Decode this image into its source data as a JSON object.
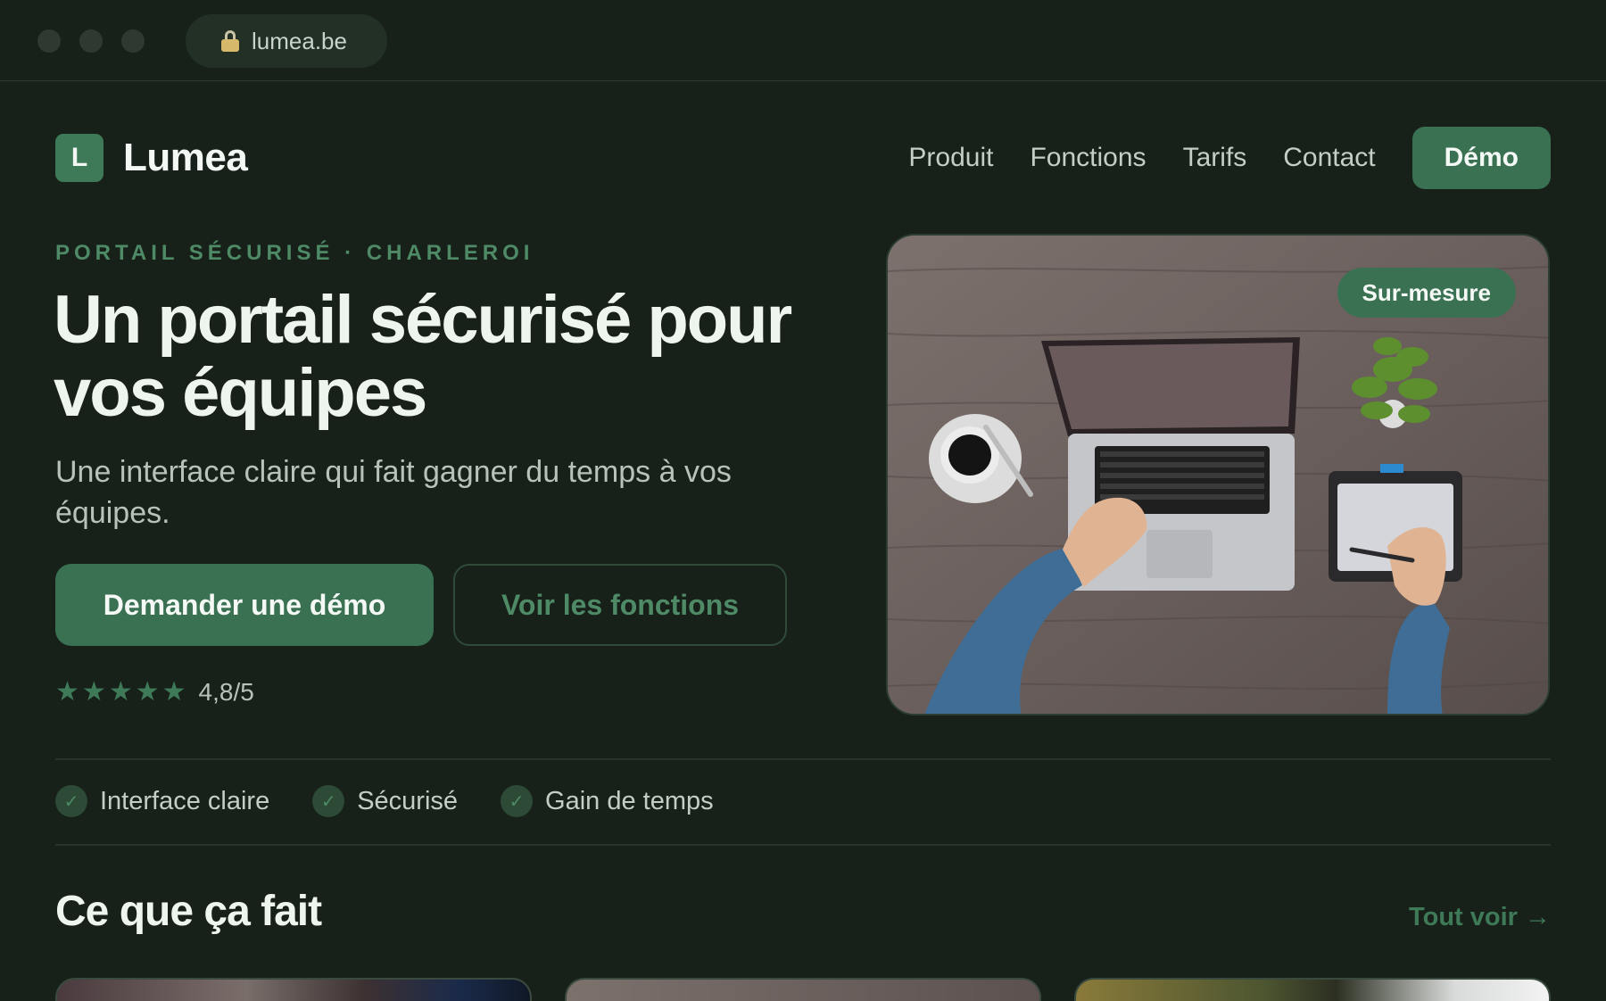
{
  "browser": {
    "url": "lumea.be"
  },
  "brand": {
    "logo_letter": "L",
    "name": "Lumea"
  },
  "nav": {
    "links": [
      "Produit",
      "Fonctions",
      "Tarifs",
      "Contact"
    ],
    "cta": "Démo"
  },
  "hero": {
    "eyebrow": "PORTAIL SÉCURISÉ · CHARLEROI",
    "title_line1": "Un portail sécurisé pour",
    "title_line2": "vos équipes",
    "subtitle": "Une interface claire qui fait gagner du temps à vos équipes.",
    "primary_button": "Demander une démo",
    "secondary_button": "Voir les fonctions",
    "rating_stars": 5,
    "rating_text": "4,8/5",
    "image_badge": "Sur-mesure"
  },
  "features": [
    "Interface claire",
    "Sécurisé",
    "Gain de temps"
  ],
  "section": {
    "title": "Ce que ça fait",
    "see_all": "Tout voir →"
  },
  "colors": {
    "background": "#172119",
    "accent": "#3a7152",
    "accent_text": "#4f8a66"
  }
}
